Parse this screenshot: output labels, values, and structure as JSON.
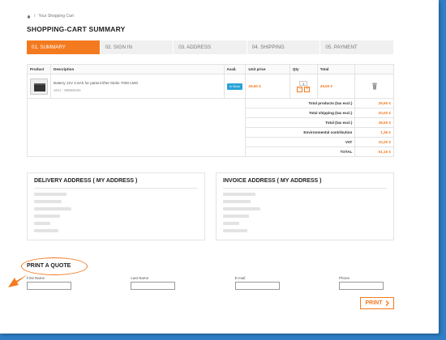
{
  "breadcrumb": {
    "current": "Your Shopping Cart"
  },
  "page_title": "SHOPPING-CART SUMMARY",
  "steps": [
    {
      "label": "01. SUMMARY"
    },
    {
      "label": "02. SIGN IN"
    },
    {
      "label": "03. ADDRESS"
    },
    {
      "label": "04. SHIPPING"
    },
    {
      "label": "05. PAYMENT"
    }
  ],
  "cart": {
    "headers": {
      "product": "Product",
      "description": "Description",
      "avail": "Avail.",
      "unit_price": "Unit price",
      "qty": "Qty",
      "total": "Total"
    },
    "item": {
      "description": "Battery 12V 2.5Ah for patient lifter Molto 7000 LMO",
      "ref": "SKU : 88889334",
      "avail": "In Stock",
      "unit_price": "29,60 €",
      "qty": "1",
      "total": "29,60 €"
    },
    "summary": [
      {
        "label": "Total products (tax excl.)",
        "value": "29,60 €"
      },
      {
        "label": "Total shipping (tax excl.)",
        "value": "20,00 €"
      },
      {
        "label": "Total (tax excl.)",
        "value": "49,50 €"
      },
      {
        "label": "Environmental contribution",
        "value": "1,36 €"
      },
      {
        "label": "VAT",
        "value": "10,20 €"
      },
      {
        "label": "TOTAL",
        "value": "61,16 €"
      }
    ]
  },
  "delivery": {
    "title": "DELIVERY ADDRESS ( MY ADDRESS )"
  },
  "invoice": {
    "title": "INVOICE ADDRESS ( MY ADDRESS )"
  },
  "quote": {
    "title": "PRINT A QUOTE",
    "fields": [
      {
        "label": "First Name"
      },
      {
        "label": "Last Name"
      },
      {
        "label": "E-mail"
      },
      {
        "label": "Phone"
      }
    ],
    "print_label": "PRINT"
  },
  "colors": {
    "accent": "#f47a20",
    "stock": "#2aa3d8",
    "background": "#2f7fc6"
  }
}
